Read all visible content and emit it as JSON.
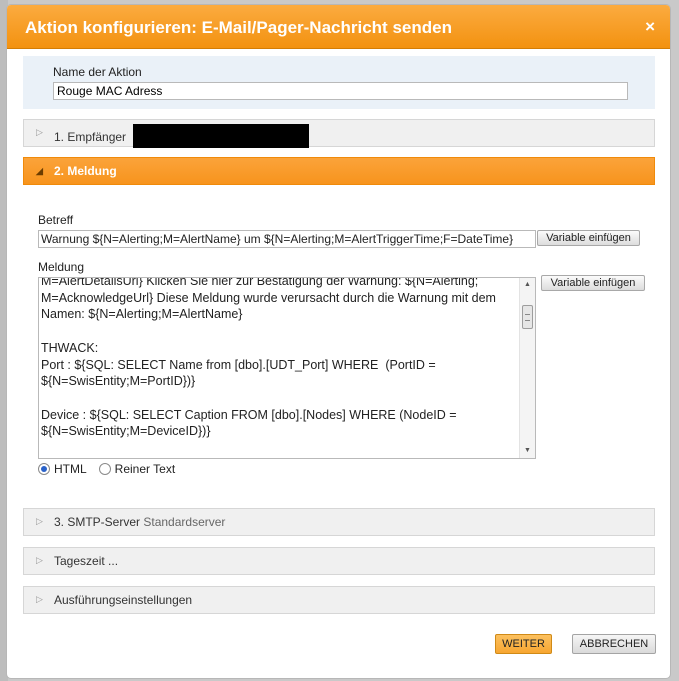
{
  "dialog": {
    "title": "Aktion konfigurieren: E-Mail/Pager-Nachricht senden",
    "close_symbol": "×"
  },
  "action_name": {
    "label": "Name der Aktion",
    "value": "Rouge MAC Adress"
  },
  "sections": {
    "recipients": {
      "arrow": "▷",
      "label": "1. Empfänger"
    },
    "message": {
      "arrow": "◢",
      "label": "2. Meldung"
    },
    "smtp": {
      "arrow": "▷",
      "label": "3. SMTP-Server",
      "sub": "Standardserver"
    },
    "time_of_day": {
      "arrow": "▷",
      "label": "Tageszeit ..."
    },
    "execution": {
      "arrow": "▷",
      "label": "Ausführungseinstellungen"
    }
  },
  "subject": {
    "label": "Betreff",
    "value": "Warnung ${N=Alerting;M=AlertName} um ${N=Alerting;M=AlertTriggerTime;F=DateTime}",
    "insert_variable_label": "Variable einfügen"
  },
  "message": {
    "label": "Meldung",
    "insert_variable_label": "Variable einfügen",
    "body": "M=AlertDetailsUrl} Klicken Sie hier zur Bestätigung der Warnung: ${N=Alerting;\nM=AcknowledgeUrl} Diese Meldung wurde verursacht durch die Warnung mit dem\nNamen: ${N=Alerting;M=AlertName}\n\nTHWACK:\nPort : ${SQL: SELECT Name from [dbo].[UDT_Port] WHERE  (PortID =\n${N=SwisEntity;M=PortID})}\n\nDevice : ${SQL: SELECT Caption FROM [dbo].[Nodes] WHERE (NodeID =\n${N=SwisEntity;M=DeviceID})}",
    "format_options": [
      {
        "label": "HTML",
        "selected": true
      },
      {
        "label": "Reiner Text",
        "selected": false
      }
    ]
  },
  "footer": {
    "next_label": "WEITER",
    "cancel_label": "ABBRECHEN"
  },
  "colors": {
    "accent": "#f7941d",
    "title_bar": "#f39210",
    "name_panel": "#eaf1f8"
  }
}
